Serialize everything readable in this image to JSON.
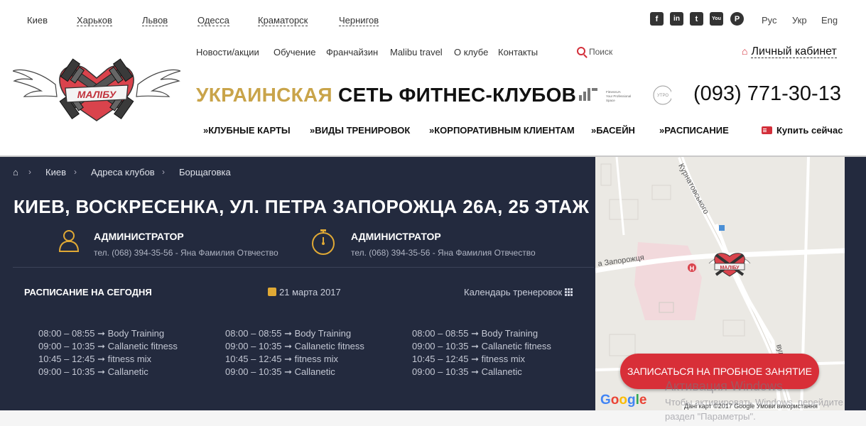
{
  "cities": [
    "Киев",
    "Харьков",
    "Львов",
    "Одесса",
    "Краматорск",
    "Чернигов"
  ],
  "social": {
    "icons": [
      "facebook-icon",
      "linkedin-icon",
      "twitter-icon",
      "youtube-icon",
      "pinterest-icon"
    ],
    "glyphs": [
      "f",
      "in",
      "t",
      "You",
      "P"
    ]
  },
  "languages": [
    "Рус",
    "Укр",
    "Eng"
  ],
  "top_nav": [
    "Новости/акции",
    "Обучение",
    "Франчайзин",
    "Malibu travel",
    "О клубе",
    "Контакты"
  ],
  "search": {
    "label": "Поиск"
  },
  "cabinet": {
    "label": "Личный кабинет"
  },
  "logo": {
    "text": "МАЛІБУ"
  },
  "tagline": {
    "gold": "УКРАИНСКАЯ",
    "black": "СЕТЬ ФИТНЕС-КЛУБОВ"
  },
  "partners": {
    "badge_text": "FitnessUA Your Professional Space",
    "round_text": "УТРО"
  },
  "phone": "(093) 771-30-13",
  "main_nav": [
    "КЛУБНЫЕ КАРТЫ",
    "ВИДЫ ТРЕНИРОВОК",
    "КОРПОРАТИВНЫМ КЛИЕНТАМ",
    "БАСЕЙН",
    "РАСПИСАНИЕ"
  ],
  "buy": {
    "label": "Купить сейчас"
  },
  "breadcrumb": [
    "Киев",
    "Адреса клубов",
    "Борщаговка"
  ],
  "address_title": "КИЕВ, ВОСКРЕСЕНКА, УЛ. ПЕТРА ЗАПОРОЖЦА 26А, 25 ЭТАЖ",
  "admins": [
    {
      "title": "АДМИНИСТРАТОР",
      "phone": "тел. (068) 394-35-56 - Яна Фамилия Отвчество",
      "icon": "person-icon"
    },
    {
      "title": "АДМИНИСТРАТОР",
      "phone": "тел. (068) 394-35-56 - Яна Фамилия Отвчество",
      "icon": "stopwatch-icon"
    }
  ],
  "schedule": {
    "title": "РАСПИСАНИЕ НА СЕГОДНЯ",
    "date": "21 марта 2017",
    "calendar_link": "Календарь тренеровок",
    "columns": [
      [
        "08:00 – 08:55 ➞ Body Training",
        "09:00 – 10:35 ➞ Callanetic fitness",
        "10:45 – 12:45 ➞ fitness mix",
        "09:00 – 10:35 ➞ Callanetic"
      ],
      [
        "08:00 – 08:55 ➞ Body Training",
        "09:00 – 10:35 ➞ Callanetic fitness",
        "10:45 – 12:45 ➞ fitness mix",
        "09:00 – 10:35 ➞ Callanetic"
      ],
      [
        "08:00 – 08:55 ➞ Body Training",
        "09:00 – 10:35 ➞ Callanetic fitness",
        "10:45 – 12:45 ➞ fitness mix",
        "09:00 – 10:35 ➞ Callanetic"
      ]
    ]
  },
  "map": {
    "street_labels": [
      "Курнатовського",
      "а Запорожця",
      "вул"
    ],
    "attribution": "Дані карт ©2017 Google   Умови використання",
    "google": "Google"
  },
  "cta": {
    "label": "ЗАПИСАТЬСЯ НА ПРОБНОЕ ЗАНЯТИЕ"
  },
  "watermark": {
    "line1": "Активация Windows",
    "line2": "Чтобы активировать Windows, перейдите",
    "line3": "раздел \"Параметры\"."
  },
  "colors": {
    "accent_red": "#d32f3a",
    "gold": "#c9a44a",
    "panel_dark": "#232a3e"
  }
}
